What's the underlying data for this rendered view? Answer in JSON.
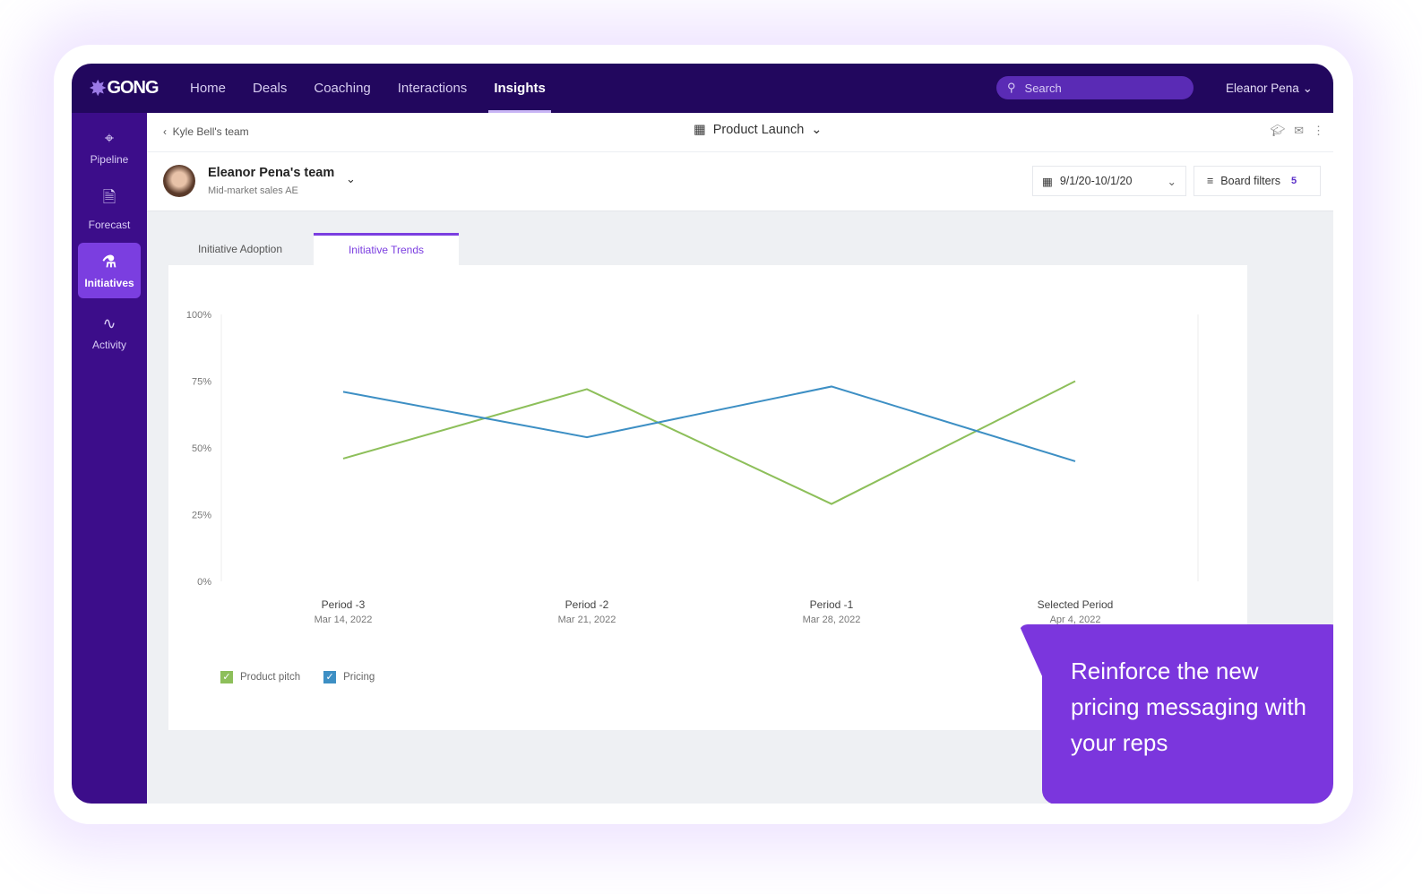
{
  "brand": "GONG",
  "nav": [
    "Home",
    "Deals",
    "Coaching",
    "Interactions",
    "Insights"
  ],
  "nav_active": "Insights",
  "search_placeholder": "Search",
  "user": "Eleanor Pena",
  "sidebar": [
    {
      "label": "Pipeline",
      "icon": "crosshair-icon"
    },
    {
      "label": "Forecast",
      "icon": "forecast-doc-icon"
    },
    {
      "label": "Initiatives",
      "icon": "flask-icon",
      "active": true
    },
    {
      "label": "Activity",
      "icon": "activity-icon"
    }
  ],
  "breadcrumb": "Kyle Bell's team",
  "board": "Product Launch",
  "team": {
    "name": "Eleanor Pena's team",
    "role": "Mid-market sales AE"
  },
  "date_range": "9/1/20-10/1/20",
  "filters": {
    "label": "Board filters",
    "count": "5"
  },
  "tabs": [
    "Initiative Adoption",
    "Initiative Trends"
  ],
  "active_tab": "Initiative Trends",
  "callout": "Reinforce the new pricing messaging with your reps",
  "chart_data": {
    "type": "line",
    "y_ticks": [
      "100%",
      "75%",
      "50%",
      "25%",
      "0%"
    ],
    "ylim": [
      0,
      100
    ],
    "categories": [
      {
        "label": "Period -3",
        "date": "Mar 14, 2022"
      },
      {
        "label": "Period -2",
        "date": "Mar 21, 2022"
      },
      {
        "label": "Period -1",
        "date": "Mar 28, 2022"
      },
      {
        "label": "Selected Period",
        "date": "Apr 4, 2022"
      }
    ],
    "series": [
      {
        "name": "Product pitch",
        "color": "#8dbf5a",
        "values": [
          46,
          72,
          29,
          75
        ]
      },
      {
        "name": "Pricing",
        "color": "#3d8fc4",
        "values": [
          71,
          54,
          73,
          45
        ]
      }
    ]
  }
}
